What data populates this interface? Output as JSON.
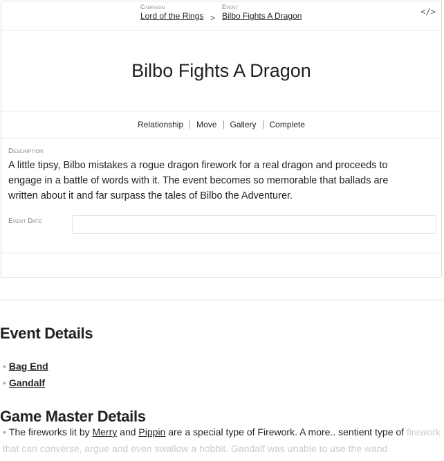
{
  "breadcrumb": {
    "campaign_label": "Campaign",
    "campaign_name": "Lord of the Rings",
    "separator": ">",
    "event_label": "Event",
    "event_name": "Bilbo Fights A Dragon"
  },
  "toolbar": {
    "code_icon": "</>"
  },
  "event": {
    "title": "Bilbo Fights A Dragon",
    "actions": [
      "Relationship",
      "Move",
      "Gallery",
      "Complete"
    ],
    "description_label": "Description",
    "description": "A little tipsy, Bilbo mistakes a rogue dragon firework for a real dragon and proceeds to engage in a battle of words with it. The event becomes so memorable that ballads are written about it and far surpass the tales of Bilbo the Adventurer.",
    "date_label": "Event Date",
    "date_value": ""
  },
  "event_details": {
    "heading": "Event Details",
    "items": [
      "Bag End",
      "Gandalf"
    ]
  },
  "gm_details": {
    "heading": "Game Master Details",
    "text_before": "The fireworks lit by ",
    "link1": "Merry",
    "text_mid": " and ",
    "link2": "Pippin",
    "text_after": " are a special type of Firework. A more.. sentient type of",
    "text_faded": "firework that can converse, argue and even swallow a hobbit. Gandalf was unable to use the wand"
  }
}
